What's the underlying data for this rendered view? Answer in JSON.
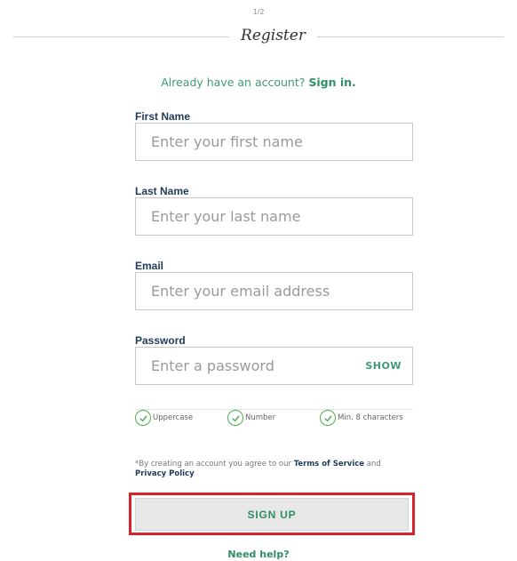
{
  "page_indicator": "1/2",
  "title": "Register",
  "signin": {
    "prompt": "Already have an account?",
    "link": "Sign in."
  },
  "fields": {
    "first_name": {
      "label": "First Name",
      "placeholder": "Enter your first name",
      "value": ""
    },
    "last_name": {
      "label": "Last Name",
      "placeholder": "Enter your last name",
      "value": ""
    },
    "email": {
      "label": "Email",
      "placeholder": "Enter your email address",
      "value": ""
    },
    "password": {
      "label": "Password",
      "placeholder": "Enter a password",
      "value": "",
      "toggle": "SHOW"
    }
  },
  "password_rules": [
    {
      "label": "Uppercase",
      "met": true
    },
    {
      "label": "Number",
      "met": true
    },
    {
      "label": "Min. 8 characters",
      "met": true
    }
  ],
  "terms": {
    "prefix": "*By creating an account you agree to our",
    "terms_link": "Terms of Service",
    "conjunction": "and",
    "privacy_link": "Privacy Policy"
  },
  "signup_label": "SIGN UP",
  "help_link": "Need help?",
  "colors": {
    "accent_green": "#2f8f64",
    "label_navy": "#1f3b5a",
    "check_green": "#4caf50",
    "highlight_red": "#d6232a"
  }
}
